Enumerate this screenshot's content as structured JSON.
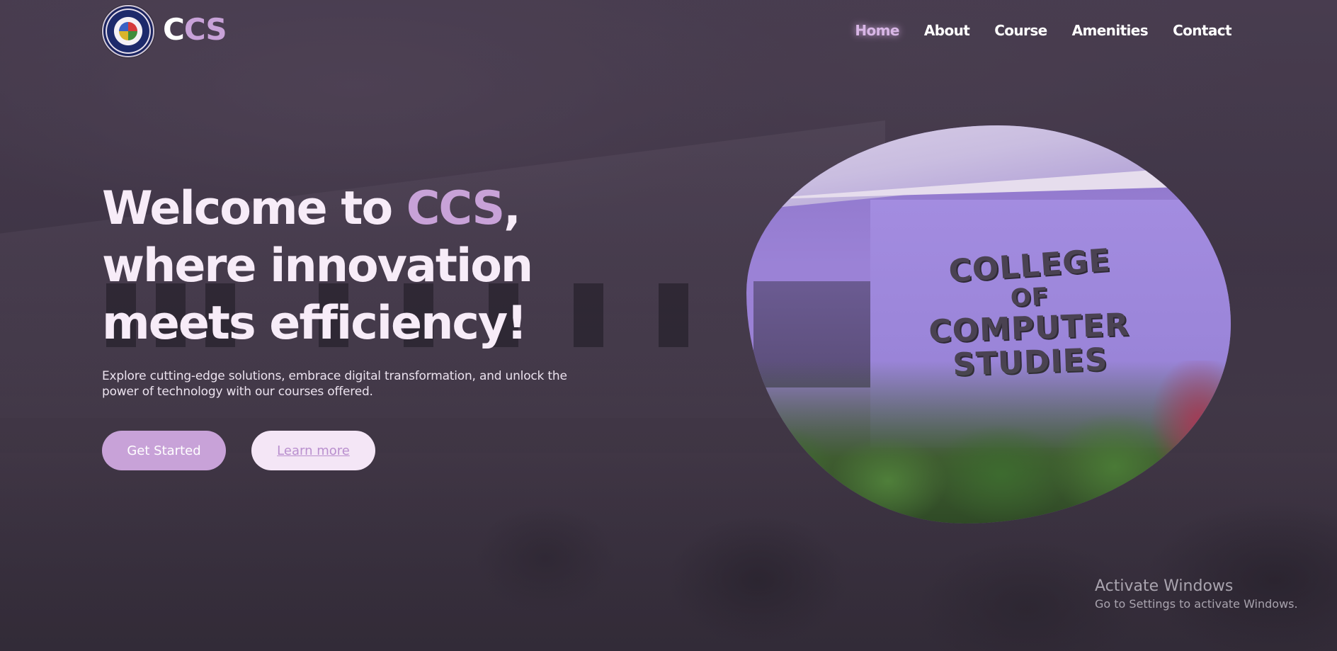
{
  "brand": {
    "name_prefix": "C",
    "name_accent": "CS"
  },
  "nav": {
    "items": [
      {
        "label": "Home",
        "active": true
      },
      {
        "label": "About"
      },
      {
        "label": "Course"
      },
      {
        "label": "Amenities"
      },
      {
        "label": "Contact"
      }
    ]
  },
  "hero": {
    "title_part1": "Welcome to ",
    "title_accent": "CCS",
    "title_part2": ", where innovation meets efficiency!",
    "subtitle": "Explore cutting-edge solutions, embrace digital transformation, and unlock the power of technology with our courses offered.",
    "primary_button": "Get Started",
    "secondary_button": "Learn more"
  },
  "image": {
    "sign_line1": "COLLEGE",
    "sign_line2": "OF",
    "sign_line3": "COMPUTER STUDIES"
  },
  "watermark": {
    "title": "Activate Windows",
    "subtitle": "Go to Settings to activate Windows."
  },
  "colors": {
    "accent": "#c8a2d8",
    "secondary_button_bg": "#f4e6f6",
    "text_light": "#f7ecf8"
  }
}
